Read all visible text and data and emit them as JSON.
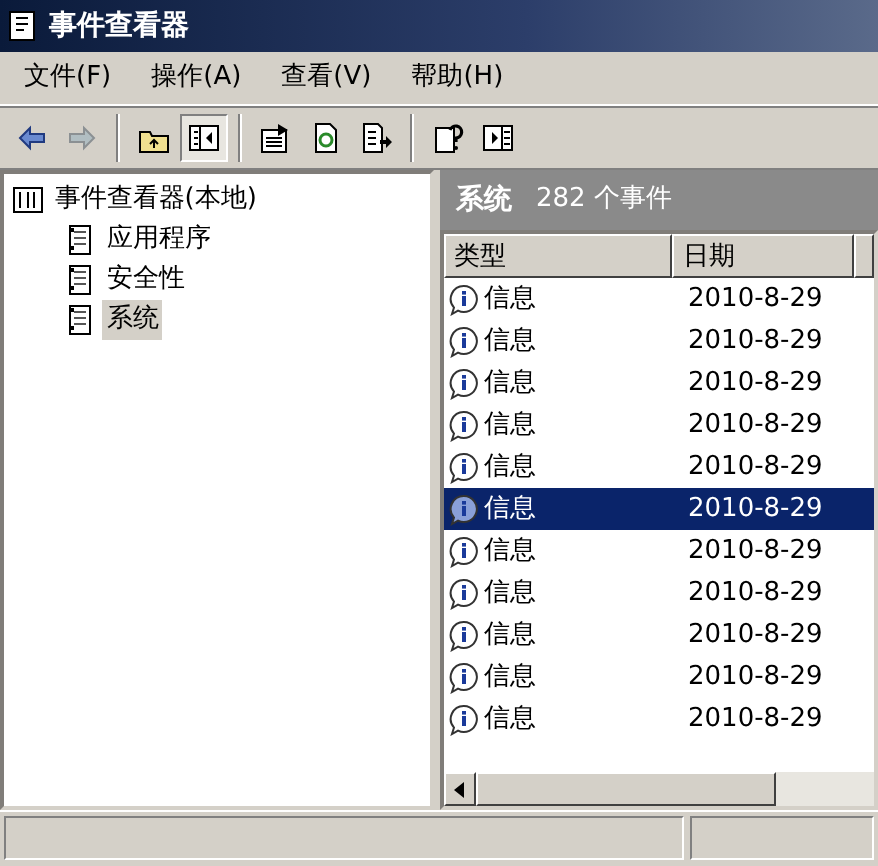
{
  "window": {
    "title": "事件查看器"
  },
  "menu": [
    {
      "label": "文件(F)"
    },
    {
      "label": "操作(A)"
    },
    {
      "label": "查看(V)"
    },
    {
      "label": "帮助(H)"
    }
  ],
  "toolbar": [
    {
      "kind": "back",
      "disabled": false,
      "pressed": false
    },
    {
      "kind": "forward",
      "disabled": true,
      "pressed": false
    },
    {
      "kind": "separator"
    },
    {
      "kind": "up",
      "disabled": false,
      "pressed": false
    },
    {
      "kind": "tree",
      "disabled": false,
      "pressed": true
    },
    {
      "kind": "separator"
    },
    {
      "kind": "properties",
      "disabled": false,
      "pressed": false
    },
    {
      "kind": "refresh",
      "disabled": false,
      "pressed": false
    },
    {
      "kind": "export",
      "disabled": false,
      "pressed": false
    },
    {
      "kind": "separator"
    },
    {
      "kind": "help",
      "disabled": false,
      "pressed": false
    },
    {
      "kind": "pane",
      "disabled": false,
      "pressed": false
    }
  ],
  "tree": {
    "label": "事件查看器(本地)",
    "selected": false,
    "children": [
      {
        "label": "应用程序",
        "selected": false
      },
      {
        "label": "安全性",
        "selected": false
      },
      {
        "label": "系统",
        "selected": true
      }
    ]
  },
  "panel": {
    "title": "系统",
    "count": "282 个事件"
  },
  "columns": [
    "类型",
    "日期"
  ],
  "rows": [
    {
      "type": "信息",
      "date": "2010-8-29",
      "selected": false
    },
    {
      "type": "信息",
      "date": "2010-8-29",
      "selected": false
    },
    {
      "type": "信息",
      "date": "2010-8-29",
      "selected": false
    },
    {
      "type": "信息",
      "date": "2010-8-29",
      "selected": false
    },
    {
      "type": "信息",
      "date": "2010-8-29",
      "selected": false
    },
    {
      "type": "信息",
      "date": "2010-8-29",
      "selected": true
    },
    {
      "type": "信息",
      "date": "2010-8-29",
      "selected": false
    },
    {
      "type": "信息",
      "date": "2010-8-29",
      "selected": false
    },
    {
      "type": "信息",
      "date": "2010-8-29",
      "selected": false
    },
    {
      "type": "信息",
      "date": "2010-8-29",
      "selected": false
    },
    {
      "type": "信息",
      "date": "2010-8-29",
      "selected": false
    }
  ]
}
